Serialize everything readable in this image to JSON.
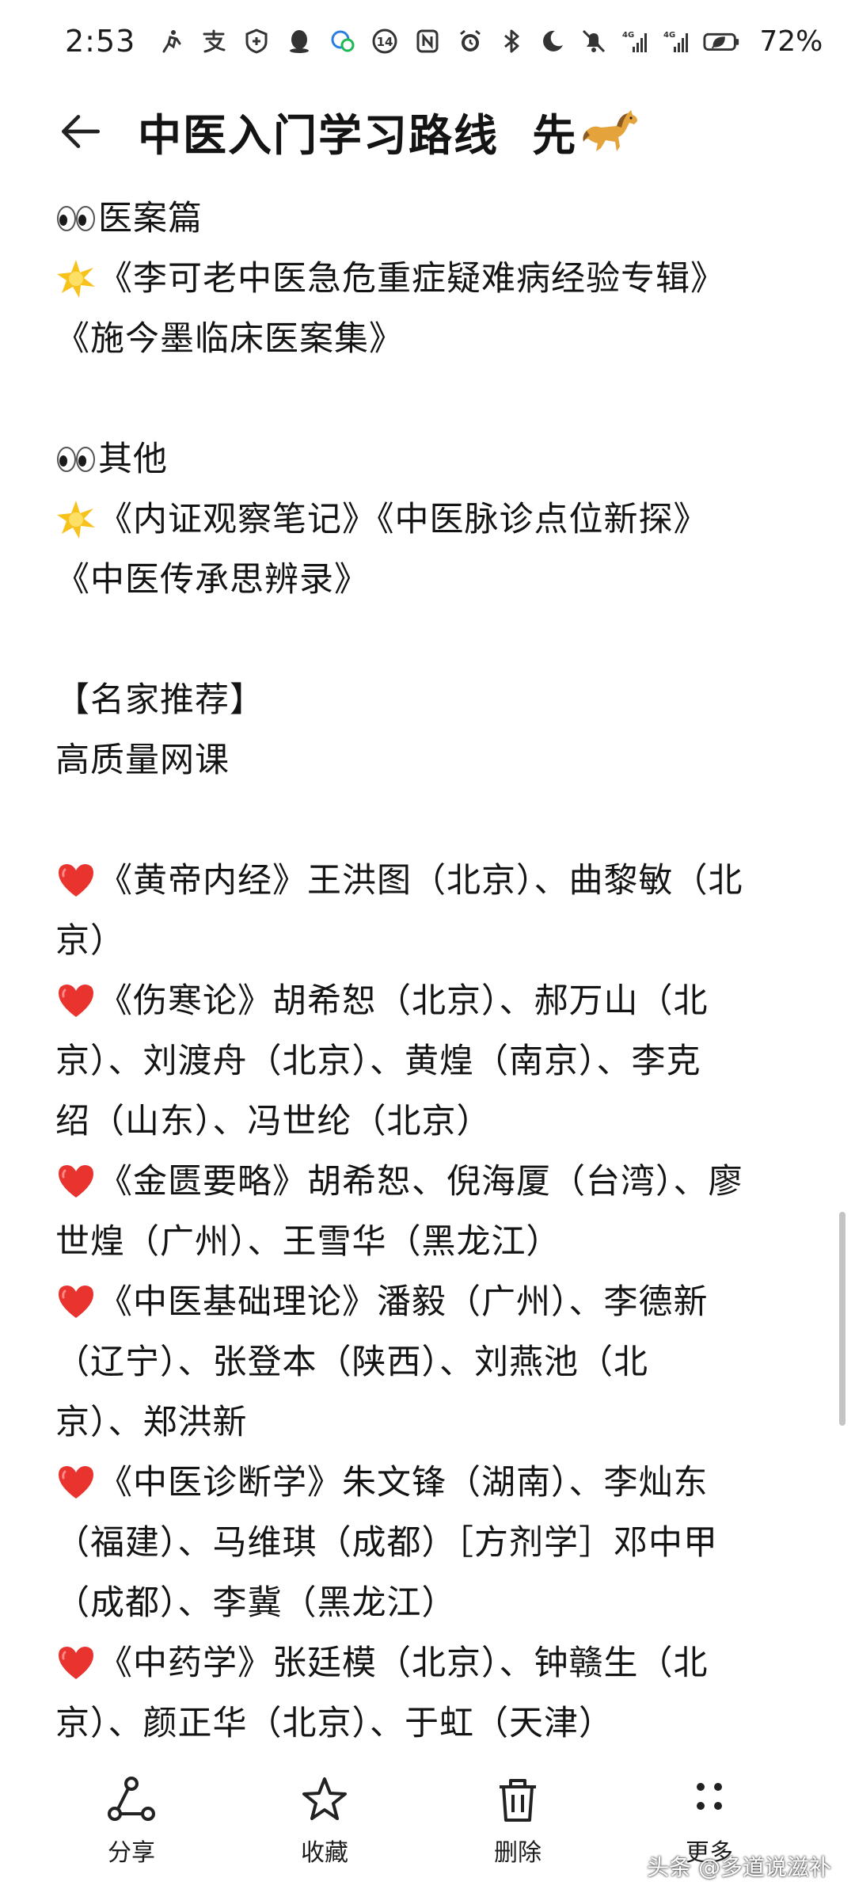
{
  "status_bar": {
    "time": "2:53",
    "battery": "72%",
    "signal_1": "4G",
    "signal_2": "4G",
    "left_icons": [
      "run-icon",
      "alipay-icon",
      "shield-app-icon",
      "qq-icon",
      "chat-icon",
      "app-14-icon",
      "nfc-icon"
    ],
    "right_icons": [
      "alarm-icon",
      "bluetooth-icon",
      "moon-icon",
      "mute-icon",
      "signal-icon",
      "signal-icon",
      "battery-icon"
    ]
  },
  "header": {
    "title": "中医入门学习路线  先",
    "title_emoji": "horse-icon"
  },
  "content": {
    "lines": [
      {
        "emoji": "eyes",
        "text": "医案篇"
      },
      {
        "emoji": "star",
        "text": "《李可老中医急危重症疑难病经验专辑》"
      },
      {
        "emoji": "",
        "text": "《施今墨临床医案集》"
      },
      {
        "emoji": "",
        "text": ""
      },
      {
        "emoji": "eyes",
        "text": "其他"
      },
      {
        "emoji": "star",
        "text": "《内证观察笔记》《中医脉诊点位新探》"
      },
      {
        "emoji": "",
        "text": "《中医传承思辨录》"
      },
      {
        "emoji": "",
        "text": ""
      },
      {
        "emoji": "",
        "text": "【名家推荐】"
      },
      {
        "emoji": "",
        "text": "高质量网课"
      },
      {
        "emoji": "",
        "text": ""
      },
      {
        "emoji": "heart",
        "text": "《黄帝内经》王洪图（北京）、曲黎敏（北"
      },
      {
        "emoji": "",
        "text": "京）"
      },
      {
        "emoji": "heart",
        "text": "《伤寒论》胡希恕（北京）、郝万山（北"
      },
      {
        "emoji": "",
        "text": "京）、刘渡舟（北京）、黄煌（南京）、李克"
      },
      {
        "emoji": "",
        "text": "绍（山东）、冯世纶（北京）"
      },
      {
        "emoji": "heart",
        "text": "《金匮要略》胡希恕、倪海厦（台湾）、廖"
      },
      {
        "emoji": "",
        "text": "世煌（广州）、王雪华（黑龙江）"
      },
      {
        "emoji": "heart",
        "text": "《中医基础理论》潘毅（广州）、李德新"
      },
      {
        "emoji": "",
        "text": "（辽宁）、张登本（陕西）、刘燕池（北"
      },
      {
        "emoji": "",
        "text": "京）、郑洪新"
      },
      {
        "emoji": "heart",
        "text": "《中医诊断学》朱文锋（湖南）、李灿东"
      },
      {
        "emoji": "",
        "text": "（福建）、马维琪（成都）［方剂学］邓中甲"
      },
      {
        "emoji": "",
        "text": "（成都）、李冀（黑龙江）"
      },
      {
        "emoji": "heart",
        "text": "《中药学》张廷模（北京）、钟赣生（北"
      },
      {
        "emoji": "",
        "text": "京）、颜正华（北京）、于虹（天津）"
      }
    ]
  },
  "toolbar": {
    "share": "分享",
    "favorite": "收藏",
    "delete": "删除",
    "more": "更多"
  },
  "watermark": "头条 @多道说滋补",
  "colors": {
    "text": "#141414",
    "background": "#ffffff",
    "heart": "#e8332f",
    "star": "#f7c21c"
  }
}
